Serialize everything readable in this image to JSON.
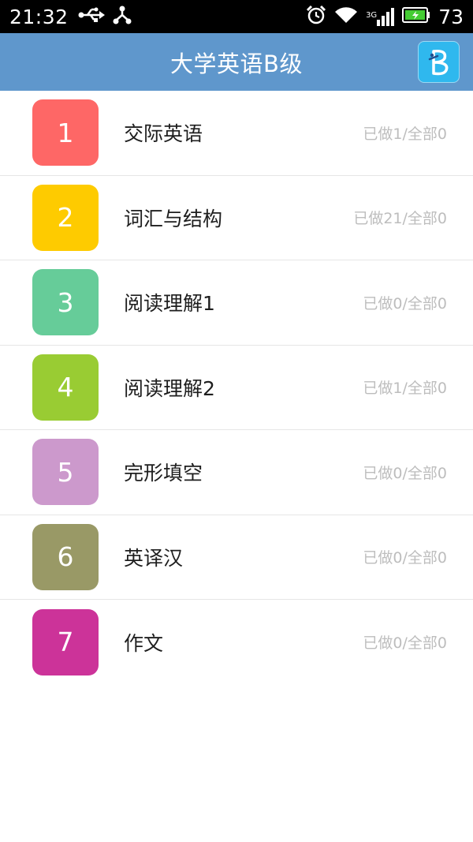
{
  "status_bar": {
    "time": "21:32",
    "battery": "73",
    "network_label": "3G",
    "icons": [
      "usb-icon",
      "share-icon",
      "alarm-icon",
      "wifi-icon",
      "signal-icon",
      "battery-icon"
    ]
  },
  "header": {
    "title": "大学英语B级",
    "logo_icon": "app-logo-icon",
    "color": "#5f97cc"
  },
  "items": [
    {
      "number": "1",
      "name": "交际英语",
      "progress": "已做1/全部0",
      "color": "#fe6766"
    },
    {
      "number": "2",
      "name": "词汇与结构",
      "progress": "已做21/全部0",
      "color": "#fecb00"
    },
    {
      "number": "3",
      "name": "阅读理解1",
      "progress": "已做0/全部0",
      "color": "#66cc99"
    },
    {
      "number": "4",
      "name": "阅读理解2",
      "progress": "已做1/全部0",
      "color": "#99cc33"
    },
    {
      "number": "5",
      "name": "完形填空",
      "progress": "已做0/全部0",
      "color": "#cc99cc"
    },
    {
      "number": "6",
      "name": "英译汉",
      "progress": "已做0/全部0",
      "color": "#999966"
    },
    {
      "number": "7",
      "name": "作文",
      "progress": "已做0/全部0",
      "color": "#cc3399"
    }
  ]
}
